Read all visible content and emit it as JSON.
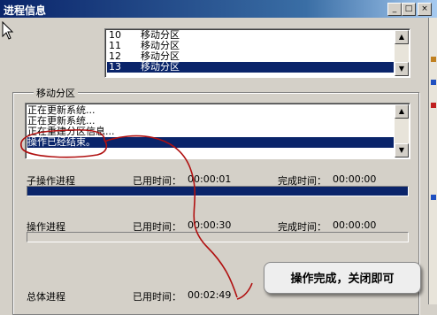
{
  "window": {
    "title": "进程信息"
  },
  "title_buttons": [
    "_",
    "□",
    "×"
  ],
  "partition_list": [
    {
      "num": "10",
      "name": "移动分区"
    },
    {
      "num": "11",
      "name": "移动分区"
    },
    {
      "num": "12",
      "name": "移动分区"
    },
    {
      "num": "13",
      "name": "移动分区"
    }
  ],
  "partition_selected_index": 3,
  "group_label": "移动分区",
  "log_lines": [
    "正在更新系统...",
    "正在更新系统...",
    "正在重建分区信息...",
    "操作已经结束。"
  ],
  "log_selected_index": 3,
  "sub_op": {
    "label": "子操作进程",
    "elapsed_label": "已用时间：",
    "elapsed": "00:00:01",
    "remain_label": "完成时间：",
    "remain": "00:00:00",
    "progress": 1.0
  },
  "op": {
    "label": "操作进程",
    "elapsed_label": "已用时间：",
    "elapsed": "00:00:30",
    "remain_label": "完成时间：",
    "remain": "00:00:00",
    "progress": 0.0
  },
  "total": {
    "label": "总体进程",
    "elapsed_label": "已用时间：",
    "elapsed": "00:02:49"
  },
  "callout": "操作完成，关闭即可",
  "colors": {
    "titlebar": "#0a246a",
    "selection": "#0a246a",
    "ink": "#b01010",
    "face": "#d4d0c8"
  },
  "icons": [
    "cursor-arrow-icon",
    "minimize-icon",
    "maximize-icon",
    "close-icon",
    "scroll-up-icon",
    "scroll-down-icon"
  ]
}
